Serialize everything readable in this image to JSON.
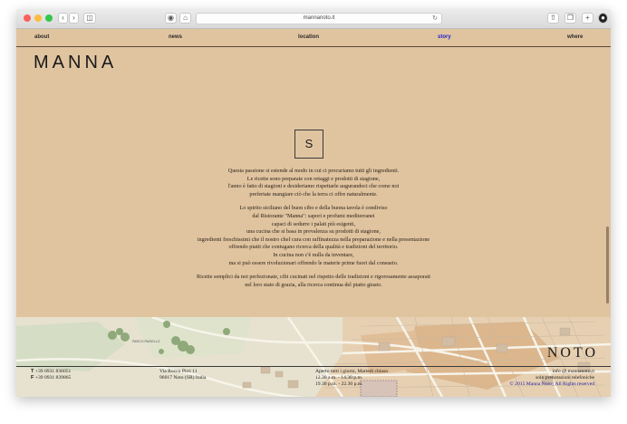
{
  "browser": {
    "url": "mannanoto.it"
  },
  "nav": {
    "items": [
      {
        "label": "about",
        "active": false
      },
      {
        "label": "news",
        "active": false
      },
      {
        "label": "location",
        "active": false
      },
      {
        "label": "story",
        "active": true
      },
      {
        "label": "where",
        "active": false
      }
    ]
  },
  "logo": "MANNA",
  "section_letter": "S",
  "story": {
    "p1": [
      "Questa passione si estende al modo in cui ci procuriamo tutti gli ingredienti.",
      "Le ricette sono preparate con ortaggi e prodotti di stagione,",
      "l'anno è fatto di stagioni e desideriamo rispettarle augurandoci che come noi",
      "preferiate mangiare ciò che la terra ci offre naturalmente."
    ],
    "p2": [
      "Lo spirito siciliano del buon cibo e della buona tavola è condiviso",
      "dal Ristorante \"Manna\": sapori e profumi mediterranei",
      "capaci di sedurre i palati più esigenti,",
      "una cucina che si basa in prevalenza su prodotti di stagione,",
      "ingredienti freschissimi che il nostro chef cura con raffinatezza nella preparazione e nella presentazione",
      "offrendo piatti che coniugano ricerca della qualità e tradizioni del territorio.",
      "In cucina non c'è nulla da inventare,",
      "ma si può essere rivoluzionari offrendo le materie prime fuori dal consueto."
    ],
    "p3": [
      "Ricette semplici da noi perfezionate, cibi cucinati nel rispetto delle tradizioni e rigorosamente assaporati",
      "nel loro stato di grazia, alla ricerca continua del piatto giusto."
    ]
  },
  "map": {
    "park_label": "PARCO PAZIELLO",
    "city_label": "NOTO"
  },
  "footer": {
    "phone_label": "T",
    "phone": "+39 0931 836051",
    "fax_label": "F",
    "fax": "+39 0931 839865",
    "address_line1": "Via Rocco Pirri 11",
    "address_line2": "96017 Noto (SR) Italia",
    "hours_line1": "Aperto tutti i giorni, Martedì chiuso",
    "hours_line2": "12.30 a.m. - 14.30 p.m.",
    "hours_line3": "19.30 p.m. - 22.30 p.m.",
    "email": "info @ mannanoto.it",
    "reservations": "solo prenotazioni telefoniche",
    "copyright": "© 2015 Manna Noto | All Rights reserved"
  },
  "colors": {
    "background": "#e0c4a0",
    "active_link": "#2222cc"
  }
}
